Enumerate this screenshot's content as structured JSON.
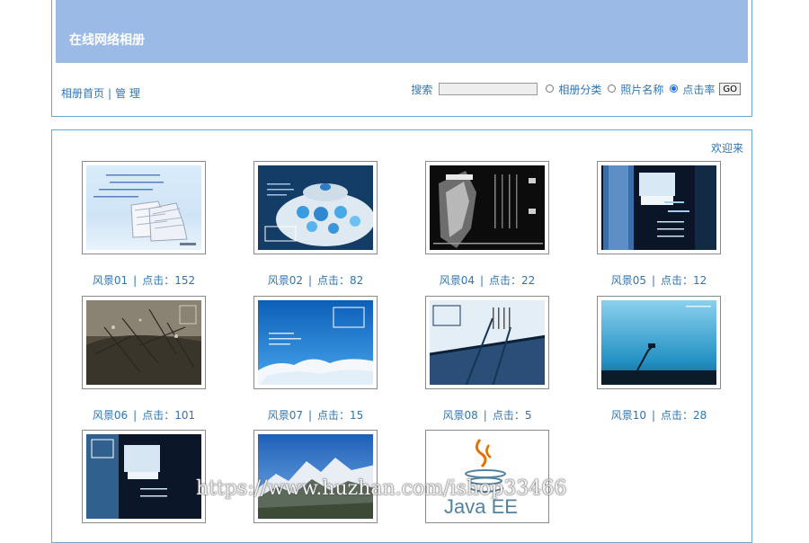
{
  "header": {
    "title": "在线网络相册"
  },
  "nav": {
    "home_label": "相册首页",
    "sep": "|",
    "manage_label": "管 理"
  },
  "search": {
    "label": "搜索",
    "value": "",
    "options": [
      {
        "label": "相册分类",
        "selected": false
      },
      {
        "label": "照片名称",
        "selected": false
      },
      {
        "label": "点击率",
        "selected": true
      }
    ],
    "go_label": "GO"
  },
  "welcome": "欢迎来",
  "photos": [
    {
      "name": "风景01",
      "clicks_label": "点击：152"
    },
    {
      "name": "风景02",
      "clicks_label": "点击：82"
    },
    {
      "name": "风景04",
      "clicks_label": "点击：22"
    },
    {
      "name": "风景05",
      "clicks_label": "点击：12"
    },
    {
      "name": "风景06",
      "clicks_label": "点击：101"
    },
    {
      "name": "风景07",
      "clicks_label": "点击：15"
    },
    {
      "name": "风景08",
      "clicks_label": "点击：5"
    },
    {
      "name": "风景10",
      "clicks_label": "点击：28"
    },
    {
      "name": "",
      "clicks_label": ""
    },
    {
      "name": "",
      "clicks_label": ""
    },
    {
      "name": "",
      "clicks_label": ""
    }
  ],
  "java_logo": {
    "text": "Java EE"
  },
  "watermark": "https://www.huzhan.com/ishop33466",
  "colors": {
    "banner": "#9bbbe6",
    "link": "#2f75b5",
    "border": "#6aa6d6"
  }
}
